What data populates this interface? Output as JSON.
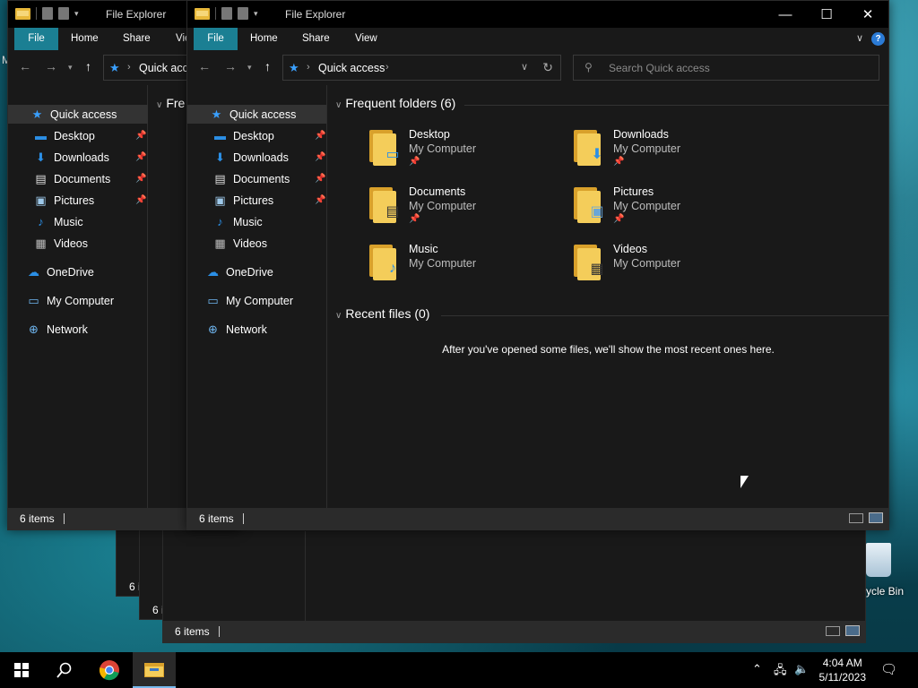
{
  "app": {
    "title": "File Explorer"
  },
  "ribbon": {
    "tabs": [
      "File",
      "Home",
      "Share",
      "View"
    ],
    "partial_tab": "Vie"
  },
  "address": {
    "location": "Quick access"
  },
  "search": {
    "placeholder": "Search Quick access"
  },
  "nav": {
    "items": [
      {
        "label": "Quick access",
        "icon": "star-icon"
      },
      {
        "label": "Desktop",
        "icon": "desktop-folder-icon",
        "pinned": true
      },
      {
        "label": "Downloads",
        "icon": "downloads-icon",
        "pinned": true
      },
      {
        "label": "Documents",
        "icon": "documents-icon",
        "pinned": true
      },
      {
        "label": "Pictures",
        "icon": "pictures-icon",
        "pinned": true
      },
      {
        "label": "Music",
        "icon": "music-icon"
      },
      {
        "label": "Videos",
        "icon": "videos-icon"
      },
      {
        "label": "OneDrive",
        "icon": "onedrive-icon"
      },
      {
        "label": "My Computer",
        "icon": "computer-icon"
      },
      {
        "label": "Network",
        "icon": "network-icon"
      }
    ]
  },
  "frequent": {
    "header": "Frequent folders (6)",
    "partial_header": "Fre",
    "folders": [
      {
        "name": "Desktop",
        "location": "My Computer",
        "pinned": true
      },
      {
        "name": "Downloads",
        "location": "My Computer",
        "pinned": true
      },
      {
        "name": "Documents",
        "location": "My Computer",
        "pinned": true
      },
      {
        "name": "Pictures",
        "location": "My Computer",
        "pinned": true
      },
      {
        "name": "Music",
        "location": "My Computer",
        "pinned": false
      },
      {
        "name": "Videos",
        "location": "My Computer",
        "pinned": false
      }
    ]
  },
  "recent": {
    "header": "Recent files (0)",
    "empty_message": "After you've opened some files, we'll show the most recent ones here."
  },
  "status": {
    "items": "6 items",
    "partial": "6 i"
  },
  "desktop": {
    "recycle_bin": "ycle Bin",
    "edge_letter": "M"
  },
  "taskbar": {
    "time": "4:04 AM",
    "date": "5/11/2023"
  },
  "colors": {
    "accent": "#1b7f93",
    "window_bg": "#191919",
    "titlebar": "#000000"
  }
}
